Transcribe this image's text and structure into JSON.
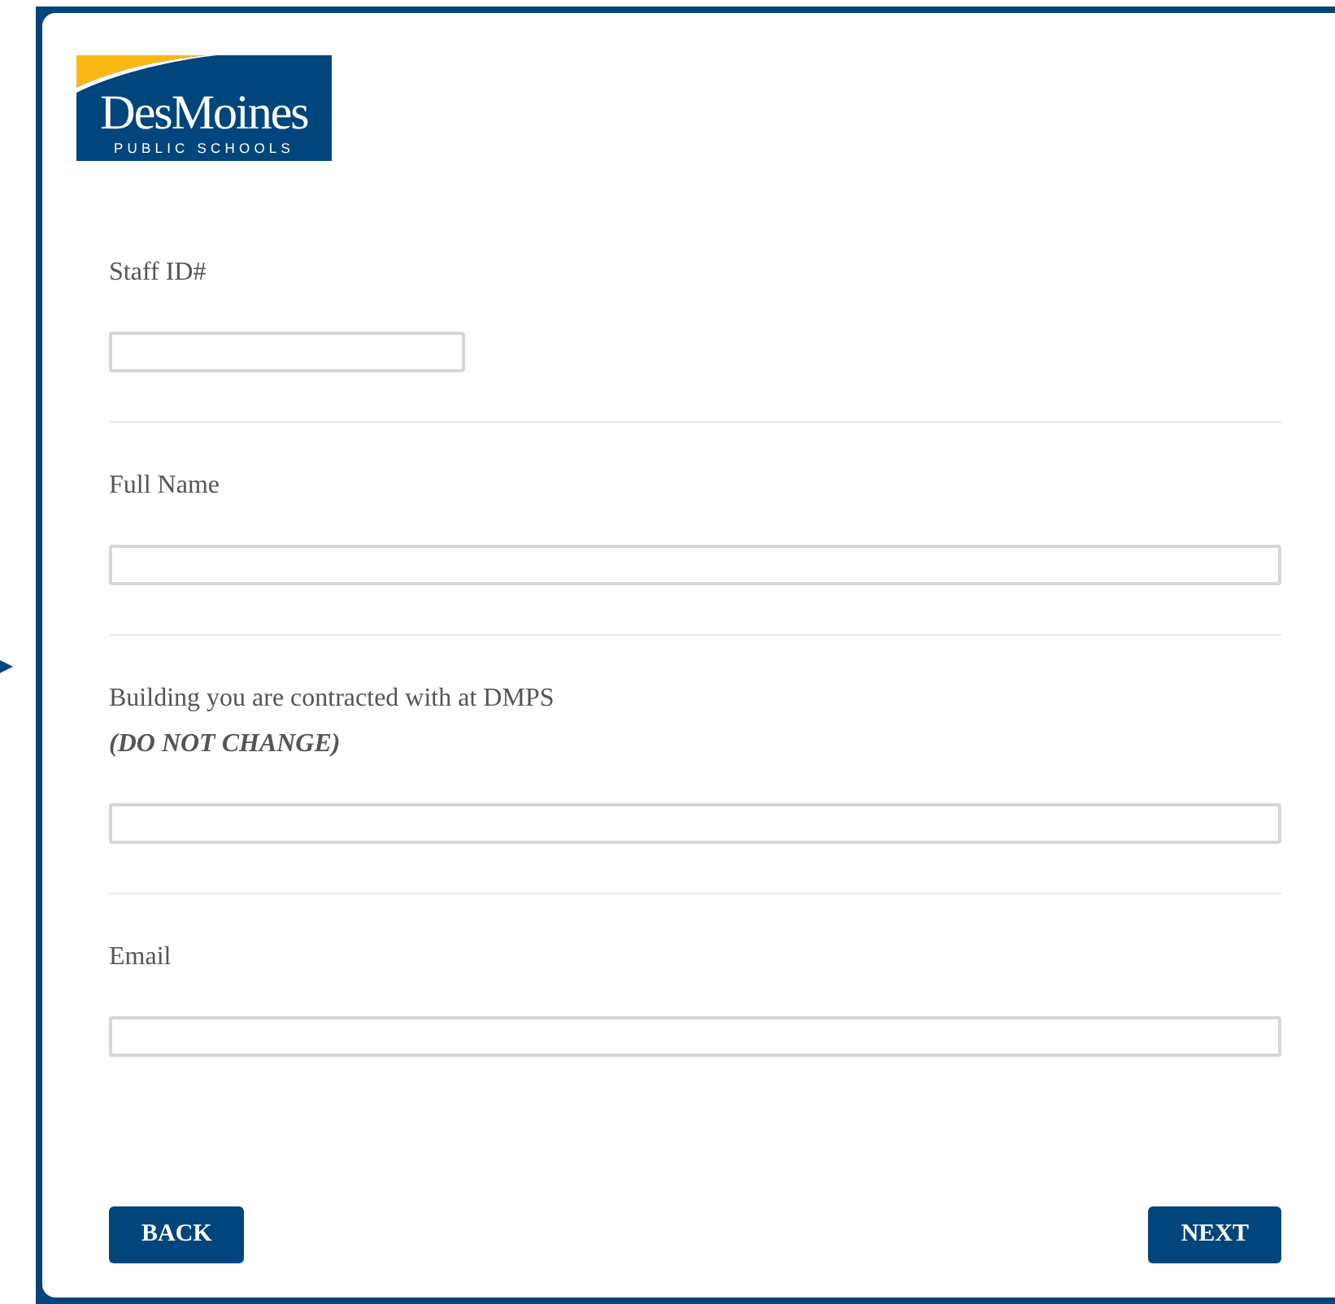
{
  "logo": {
    "name": "DesMoines",
    "subtitle": "PUBLIC SCHOOLS"
  },
  "fields": [
    {
      "label": "Staff ID#",
      "kind": "short"
    },
    {
      "label": "Full Name",
      "kind": "wide"
    },
    {
      "label": "Building you are contracted with at DMPS",
      "note": "(DO NOT CHANGE)",
      "kind": "wide"
    },
    {
      "label": "Email",
      "kind": "wide"
    }
  ],
  "buttons": [
    {
      "label": "BACK"
    },
    {
      "label": "NEXT"
    }
  ]
}
